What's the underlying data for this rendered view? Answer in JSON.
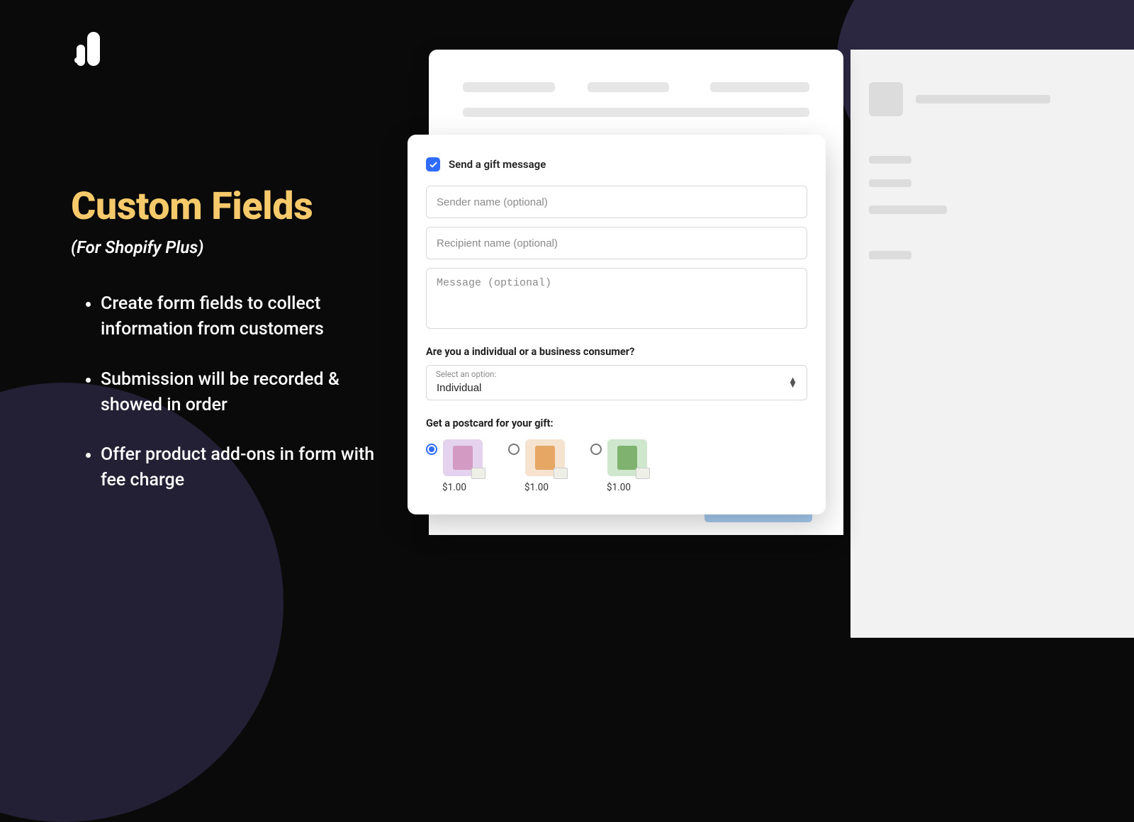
{
  "left": {
    "title": "Custom Fields",
    "subtitle": "(For Shopify Plus)",
    "bullets": [
      "Create form fields to collect information from customers",
      "Submission will be recorded & showed in order",
      "Offer product add-ons in form with fee charge"
    ]
  },
  "form": {
    "checkbox_label": "Send a gift message",
    "checkbox_checked": true,
    "sender_placeholder": "Sender name (optional)",
    "recipient_placeholder": "Recipient name (optional)",
    "message_placeholder": "Message (optional)",
    "consumer_question": "Are you a individual or a business consumer?",
    "select_float": "Select an option:",
    "select_value": "Individual",
    "postcard_label": "Get a postcard for your gift:",
    "postcards": [
      {
        "price": "$1.00",
        "selected": true,
        "bg": "#e5d2ee",
        "inner": "#d39bc4"
      },
      {
        "price": "$1.00",
        "selected": false,
        "bg": "#f6e3cf",
        "inner": "#e6a765"
      },
      {
        "price": "$1.00",
        "selected": false,
        "bg": "#cfe7cd",
        "inner": "#7fb26f"
      }
    ]
  }
}
